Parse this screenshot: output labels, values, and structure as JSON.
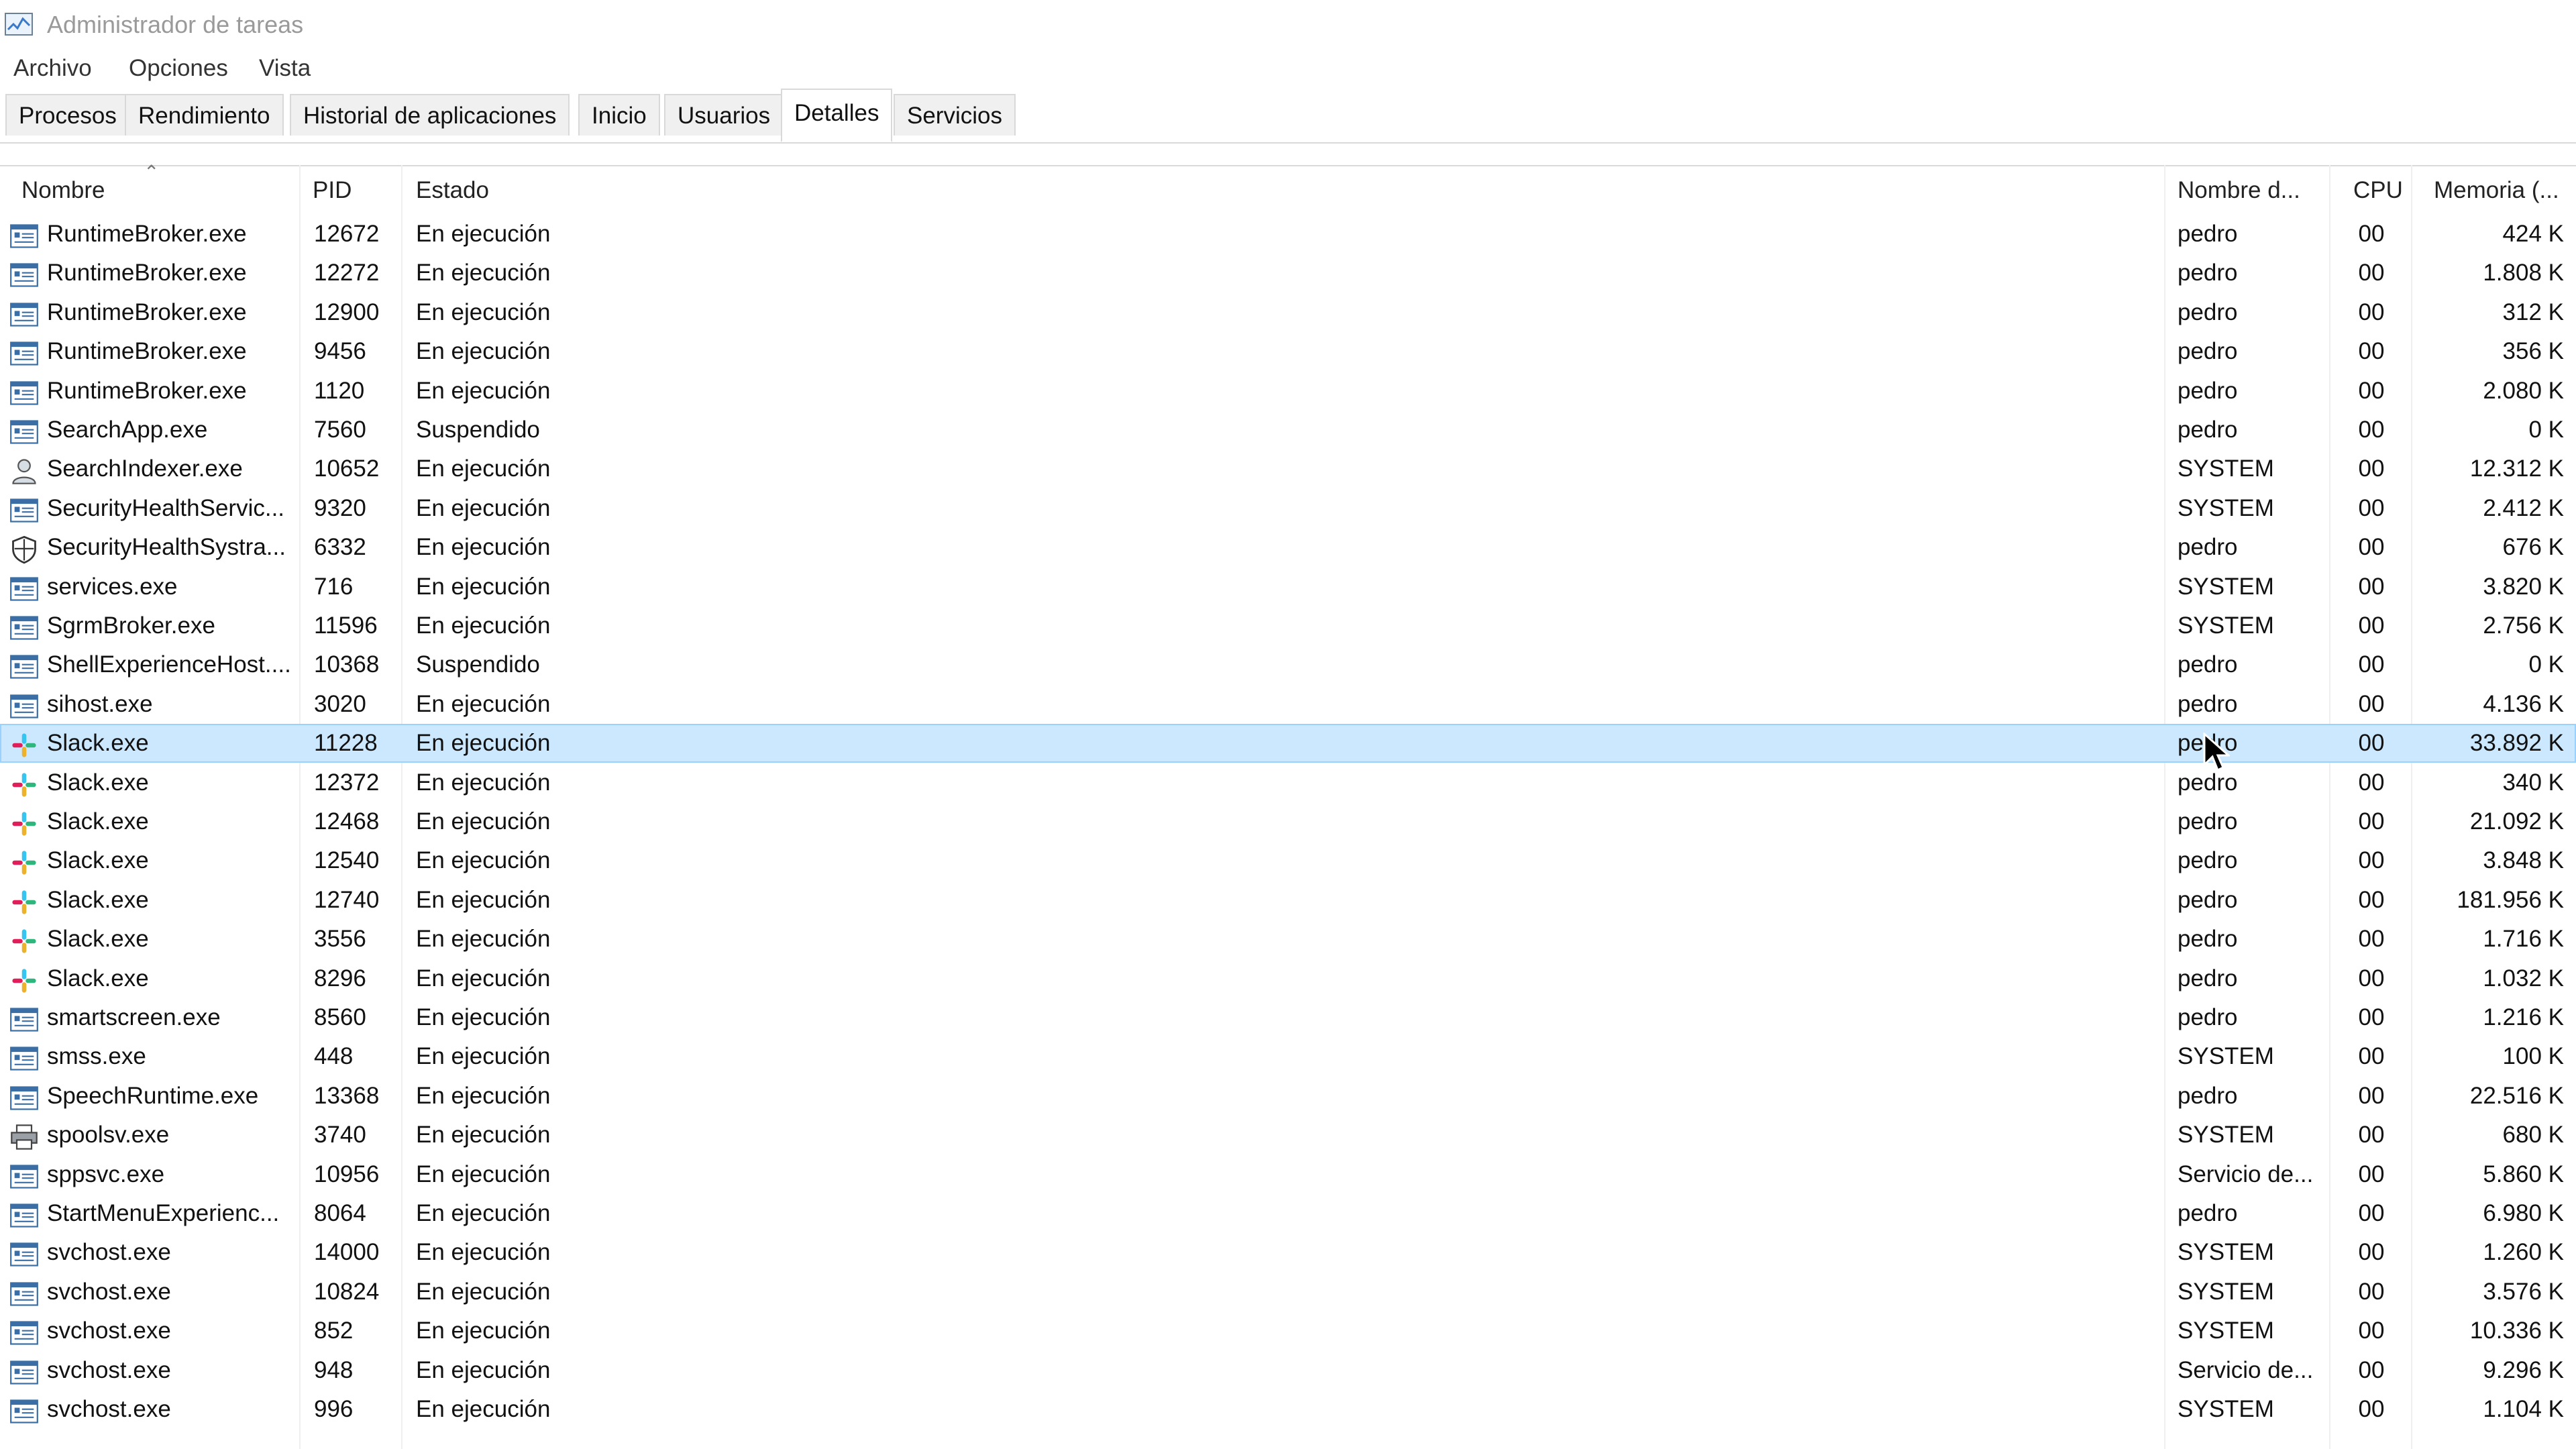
{
  "window": {
    "title": "Administrador de tareas"
  },
  "menu": [
    "Archivo",
    "Opciones",
    "Vista"
  ],
  "tabs": [
    "Procesos",
    "Rendimiento",
    "Historial de aplicaciones",
    "Inicio",
    "Usuarios",
    "Detalles",
    "Servicios"
  ],
  "active_tab": "Detalles",
  "columns": {
    "name": "Nombre",
    "pid": "PID",
    "status": "Estado",
    "user": "Nombre d...",
    "cpu": "CPU",
    "memory": "Memoria (..."
  },
  "colors": {
    "selected_row": "#cce8ff",
    "tab_inactive": "#f0f0f0",
    "title_text": "#9a9a9a"
  },
  "processes": [
    {
      "name": "RuntimeBroker.exe",
      "pid": "12672",
      "status": "En ejecución",
      "user": "pedro",
      "cpu": "00",
      "memory": "424 K",
      "icon": "app-window-icon"
    },
    {
      "name": "RuntimeBroker.exe",
      "pid": "12272",
      "status": "En ejecución",
      "user": "pedro",
      "cpu": "00",
      "memory": "1.808 K",
      "icon": "app-window-icon"
    },
    {
      "name": "RuntimeBroker.exe",
      "pid": "12900",
      "status": "En ejecución",
      "user": "pedro",
      "cpu": "00",
      "memory": "312 K",
      "icon": "app-window-icon"
    },
    {
      "name": "RuntimeBroker.exe",
      "pid": "9456",
      "status": "En ejecución",
      "user": "pedro",
      "cpu": "00",
      "memory": "356 K",
      "icon": "app-window-icon"
    },
    {
      "name": "RuntimeBroker.exe",
      "pid": "1120",
      "status": "En ejecución",
      "user": "pedro",
      "cpu": "00",
      "memory": "2.080 K",
      "icon": "app-window-icon"
    },
    {
      "name": "SearchApp.exe",
      "pid": "7560",
      "status": "Suspendido",
      "user": "pedro",
      "cpu": "00",
      "memory": "0 K",
      "icon": "app-window-icon"
    },
    {
      "name": "SearchIndexer.exe",
      "pid": "10652",
      "status": "En ejecución",
      "user": "SYSTEM",
      "cpu": "00",
      "memory": "12.312 K",
      "icon": "search-indexer-icon"
    },
    {
      "name": "SecurityHealthServic...",
      "pid": "9320",
      "status": "En ejecución",
      "user": "SYSTEM",
      "cpu": "00",
      "memory": "2.412 K",
      "icon": "app-window-icon"
    },
    {
      "name": "SecurityHealthSystra...",
      "pid": "6332",
      "status": "En ejecución",
      "user": "pedro",
      "cpu": "00",
      "memory": "676 K",
      "icon": "shield-icon"
    },
    {
      "name": "services.exe",
      "pid": "716",
      "status": "En ejecución",
      "user": "SYSTEM",
      "cpu": "00",
      "memory": "3.820 K",
      "icon": "app-window-icon"
    },
    {
      "name": "SgrmBroker.exe",
      "pid": "11596",
      "status": "En ejecución",
      "user": "SYSTEM",
      "cpu": "00",
      "memory": "2.756 K",
      "icon": "app-window-icon"
    },
    {
      "name": "ShellExperienceHost....",
      "pid": "10368",
      "status": "Suspendido",
      "user": "pedro",
      "cpu": "00",
      "memory": "0 K",
      "icon": "app-window-icon"
    },
    {
      "name": "sihost.exe",
      "pid": "3020",
      "status": "En ejecución",
      "user": "pedro",
      "cpu": "00",
      "memory": "4.136 K",
      "icon": "app-window-icon"
    },
    {
      "name": "Slack.exe",
      "pid": "11228",
      "status": "En ejecución",
      "user": "pedro",
      "cpu": "00",
      "memory": "33.892 K",
      "icon": "slack-icon",
      "selected": true
    },
    {
      "name": "Slack.exe",
      "pid": "12372",
      "status": "En ejecución",
      "user": "pedro",
      "cpu": "00",
      "memory": "340 K",
      "icon": "slack-icon"
    },
    {
      "name": "Slack.exe",
      "pid": "12468",
      "status": "En ejecución",
      "user": "pedro",
      "cpu": "00",
      "memory": "21.092 K",
      "icon": "slack-icon"
    },
    {
      "name": "Slack.exe",
      "pid": "12540",
      "status": "En ejecución",
      "user": "pedro",
      "cpu": "00",
      "memory": "3.848 K",
      "icon": "slack-icon"
    },
    {
      "name": "Slack.exe",
      "pid": "12740",
      "status": "En ejecución",
      "user": "pedro",
      "cpu": "00",
      "memory": "181.956 K",
      "icon": "slack-icon"
    },
    {
      "name": "Slack.exe",
      "pid": "3556",
      "status": "En ejecución",
      "user": "pedro",
      "cpu": "00",
      "memory": "1.716 K",
      "icon": "slack-icon"
    },
    {
      "name": "Slack.exe",
      "pid": "8296",
      "status": "En ejecución",
      "user": "pedro",
      "cpu": "00",
      "memory": "1.032 K",
      "icon": "slack-icon"
    },
    {
      "name": "smartscreen.exe",
      "pid": "8560",
      "status": "En ejecución",
      "user": "pedro",
      "cpu": "00",
      "memory": "1.216 K",
      "icon": "app-window-icon"
    },
    {
      "name": "smss.exe",
      "pid": "448",
      "status": "En ejecución",
      "user": "SYSTEM",
      "cpu": "00",
      "memory": "100 K",
      "icon": "app-window-icon"
    },
    {
      "name": "SpeechRuntime.exe",
      "pid": "13368",
      "status": "En ejecución",
      "user": "pedro",
      "cpu": "00",
      "memory": "22.516 K",
      "icon": "app-window-icon"
    },
    {
      "name": "spoolsv.exe",
      "pid": "3740",
      "status": "En ejecución",
      "user": "SYSTEM",
      "cpu": "00",
      "memory": "680 K",
      "icon": "printer-icon"
    },
    {
      "name": "sppsvc.exe",
      "pid": "10956",
      "status": "En ejecución",
      "user": "Servicio de...",
      "cpu": "00",
      "memory": "5.860 K",
      "icon": "app-window-icon"
    },
    {
      "name": "StartMenuExperienc...",
      "pid": "8064",
      "status": "En ejecución",
      "user": "pedro",
      "cpu": "00",
      "memory": "6.980 K",
      "icon": "app-window-icon"
    },
    {
      "name": "svchost.exe",
      "pid": "14000",
      "status": "En ejecución",
      "user": "SYSTEM",
      "cpu": "00",
      "memory": "1.260 K",
      "icon": "app-window-icon"
    },
    {
      "name": "svchost.exe",
      "pid": "10824",
      "status": "En ejecución",
      "user": "SYSTEM",
      "cpu": "00",
      "memory": "3.576 K",
      "icon": "app-window-icon"
    },
    {
      "name": "svchost.exe",
      "pid": "852",
      "status": "En ejecución",
      "user": "SYSTEM",
      "cpu": "00",
      "memory": "10.336 K",
      "icon": "app-window-icon"
    },
    {
      "name": "svchost.exe",
      "pid": "948",
      "status": "En ejecución",
      "user": "Servicio de...",
      "cpu": "00",
      "memory": "9.296 K",
      "icon": "app-window-icon"
    },
    {
      "name": "svchost.exe",
      "pid": "996",
      "status": "En ejecución",
      "user": "SYSTEM",
      "cpu": "00",
      "memory": "1.104 K",
      "icon": "app-window-icon"
    }
  ]
}
